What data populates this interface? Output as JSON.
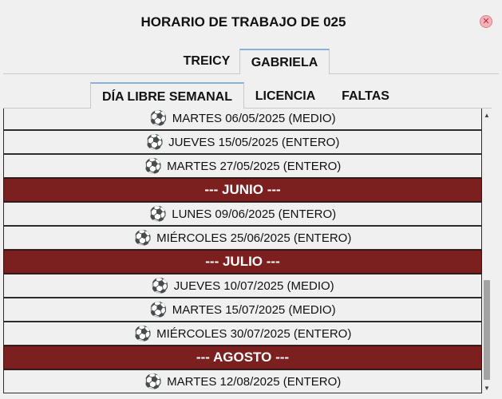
{
  "window": {
    "title": "HORARIO DE TRABAJO DE 025",
    "close_glyph": "✕",
    "close_icon": "close-icon"
  },
  "tabs": [
    {
      "label": "TREICY"
    },
    {
      "label": "GABRIELA"
    }
  ],
  "subtabs": [
    {
      "label": "DÍA LIBRE SEMANAL"
    },
    {
      "label": "LICENCIA"
    },
    {
      "label": "FALTAS"
    }
  ],
  "colors": {
    "month_header": "#7b1f1f",
    "tab_accent": "#8ab0dd"
  },
  "list": {
    "rows": [
      {
        "kind": "day",
        "text": "MARTES 06/05/2025 (MEDIO)",
        "icon": "soccer-ball-icon"
      },
      {
        "kind": "day",
        "text": "JUEVES 15/05/2025 (ENTERO)",
        "icon": "soccer-ball-icon"
      },
      {
        "kind": "day",
        "text": "MARTES 27/05/2025 (ENTERO)",
        "icon": "soccer-ball-icon"
      },
      {
        "kind": "month",
        "text": "--- JUNIO ---"
      },
      {
        "kind": "day",
        "text": "LUNES 09/06/2025 (ENTERO)",
        "icon": "soccer-ball-icon"
      },
      {
        "kind": "day",
        "text": "MIÉRCOLES 25/06/2025 (ENTERO)",
        "icon": "soccer-ball-icon"
      },
      {
        "kind": "month",
        "text": "--- JULIO ---"
      },
      {
        "kind": "day",
        "text": "JUEVES 10/07/2025 (MEDIO)",
        "icon": "soccer-ball-icon"
      },
      {
        "kind": "day",
        "text": "MARTES 15/07/2025 (MEDIO)",
        "icon": "soccer-ball-icon"
      },
      {
        "kind": "day",
        "text": "MIÉRCOLES 30/07/2025 (ENTERO)",
        "icon": "soccer-ball-icon"
      },
      {
        "kind": "month",
        "text": "--- AGOSTO ---"
      },
      {
        "kind": "day",
        "text": "MARTES 12/08/2025 (ENTERO)",
        "icon": "soccer-ball-icon"
      }
    ]
  },
  "scrollbar": {
    "up_glyph": "▲",
    "down_glyph": "▼"
  }
}
